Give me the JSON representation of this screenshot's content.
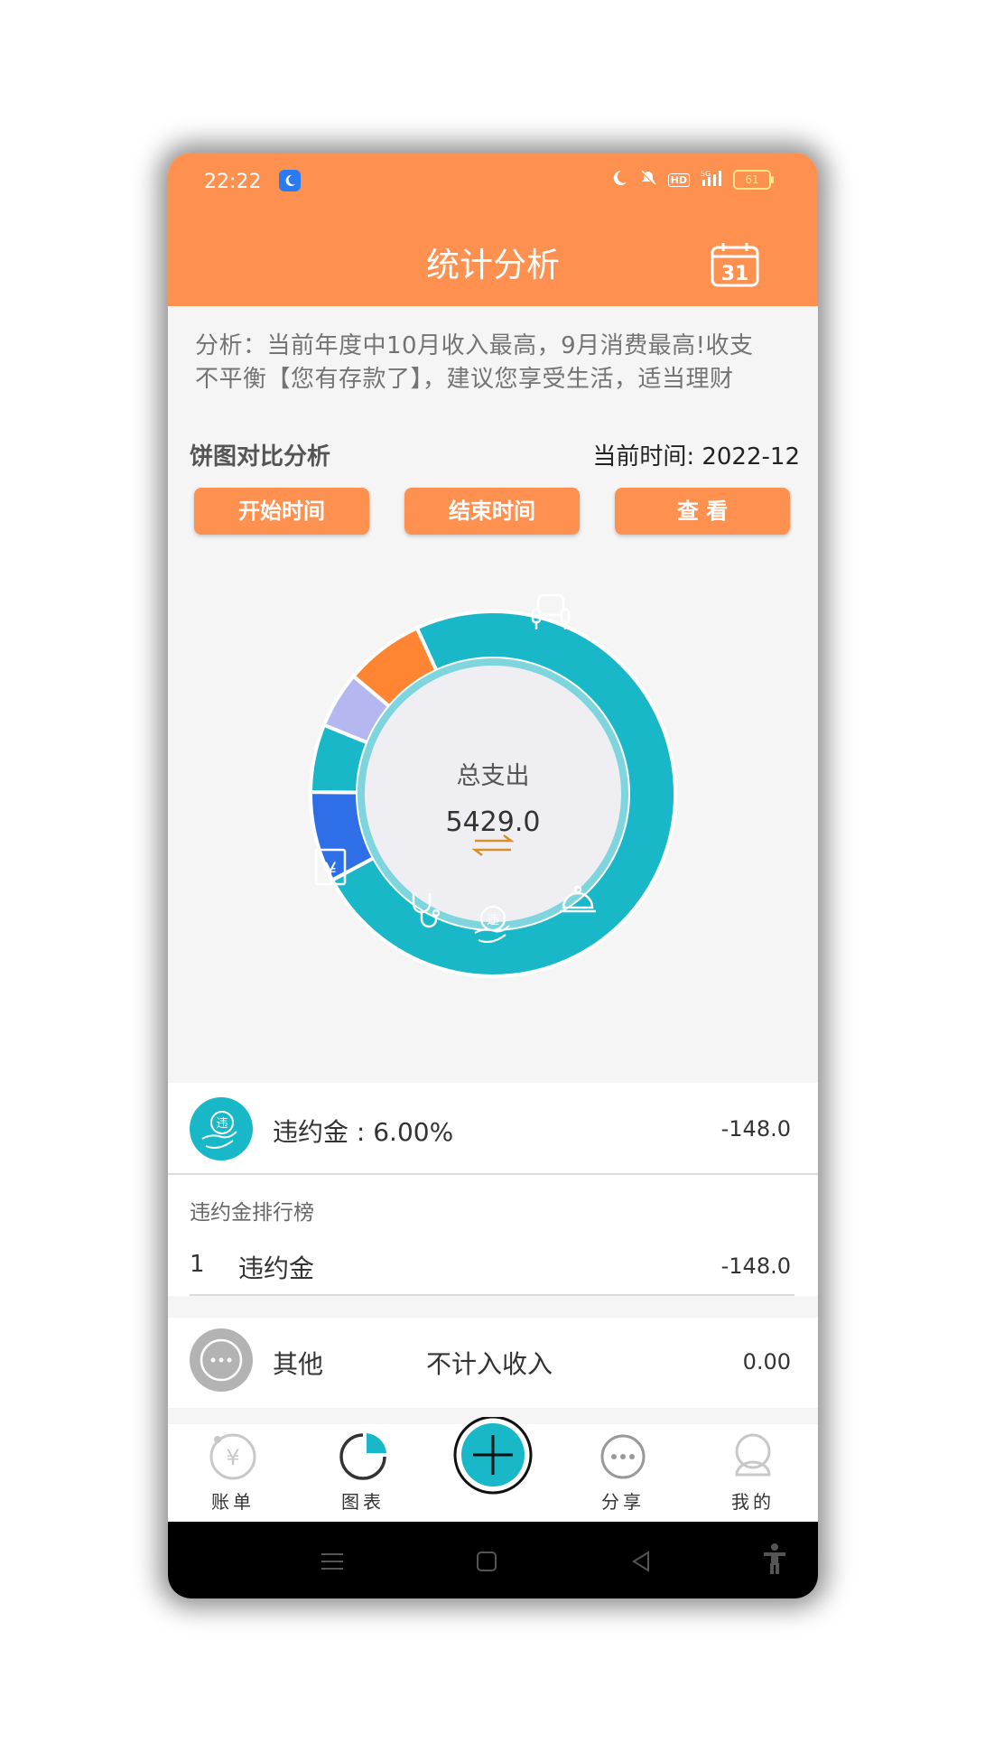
{
  "status": {
    "time": "22:22",
    "battery": "61",
    "network": "5G",
    "hd": "HD"
  },
  "header": {
    "title": "统计分析",
    "calendar_day": "31"
  },
  "analysis": {
    "line1": "分析：当前年度中10月收入最高，9月消费最高!收支",
    "line2": "不平衡【您有存款了】，建议您享受生活，适当理财"
  },
  "pie_section": {
    "title": "饼图对比分析",
    "current_time": "当前时间: 2022-12"
  },
  "buttons": {
    "start": "开始时间",
    "end": "结束时间",
    "view": "查 看"
  },
  "donut": {
    "center_label": "总支出",
    "total": "5429.0",
    "colors": {
      "teal": "#18b8c8",
      "orange": "#ff8533",
      "lavender": "#b4b7f0",
      "blue": "#2e6fe8"
    }
  },
  "chart_data": {
    "type": "pie",
    "title": "",
    "series": [
      {
        "name": "",
        "icon": "sofa-icon",
        "value": 0.74,
        "color": "#18b8c8"
      },
      {
        "name": "",
        "icon": "restaurant-icon",
        "value": 0.08,
        "color": "#2e6fe8"
      },
      {
        "name": "违约金",
        "icon": "penalty-icon",
        "value": 0.06,
        "color": "#18b8c8"
      },
      {
        "name": "",
        "icon": "medical-icon",
        "value": 0.05,
        "color": "#b4b7f0"
      },
      {
        "name": "",
        "icon": "money-receipt-icon",
        "value": 0.07,
        "color": "#ff8533"
      }
    ]
  },
  "selected": {
    "label": "违约金 : 6.00%",
    "amount": "-148.0",
    "icon_char": "违"
  },
  "ranking": {
    "title": "违约金排行榜",
    "rows": [
      {
        "rank": "1",
        "name": "违约金",
        "amount": "-148.0"
      }
    ]
  },
  "other": {
    "label": "其他",
    "note": "不计入收入",
    "amount": "0.00"
  },
  "nav": {
    "bills": "账单",
    "chart": "图表",
    "share": "分享",
    "mine": "我的"
  }
}
